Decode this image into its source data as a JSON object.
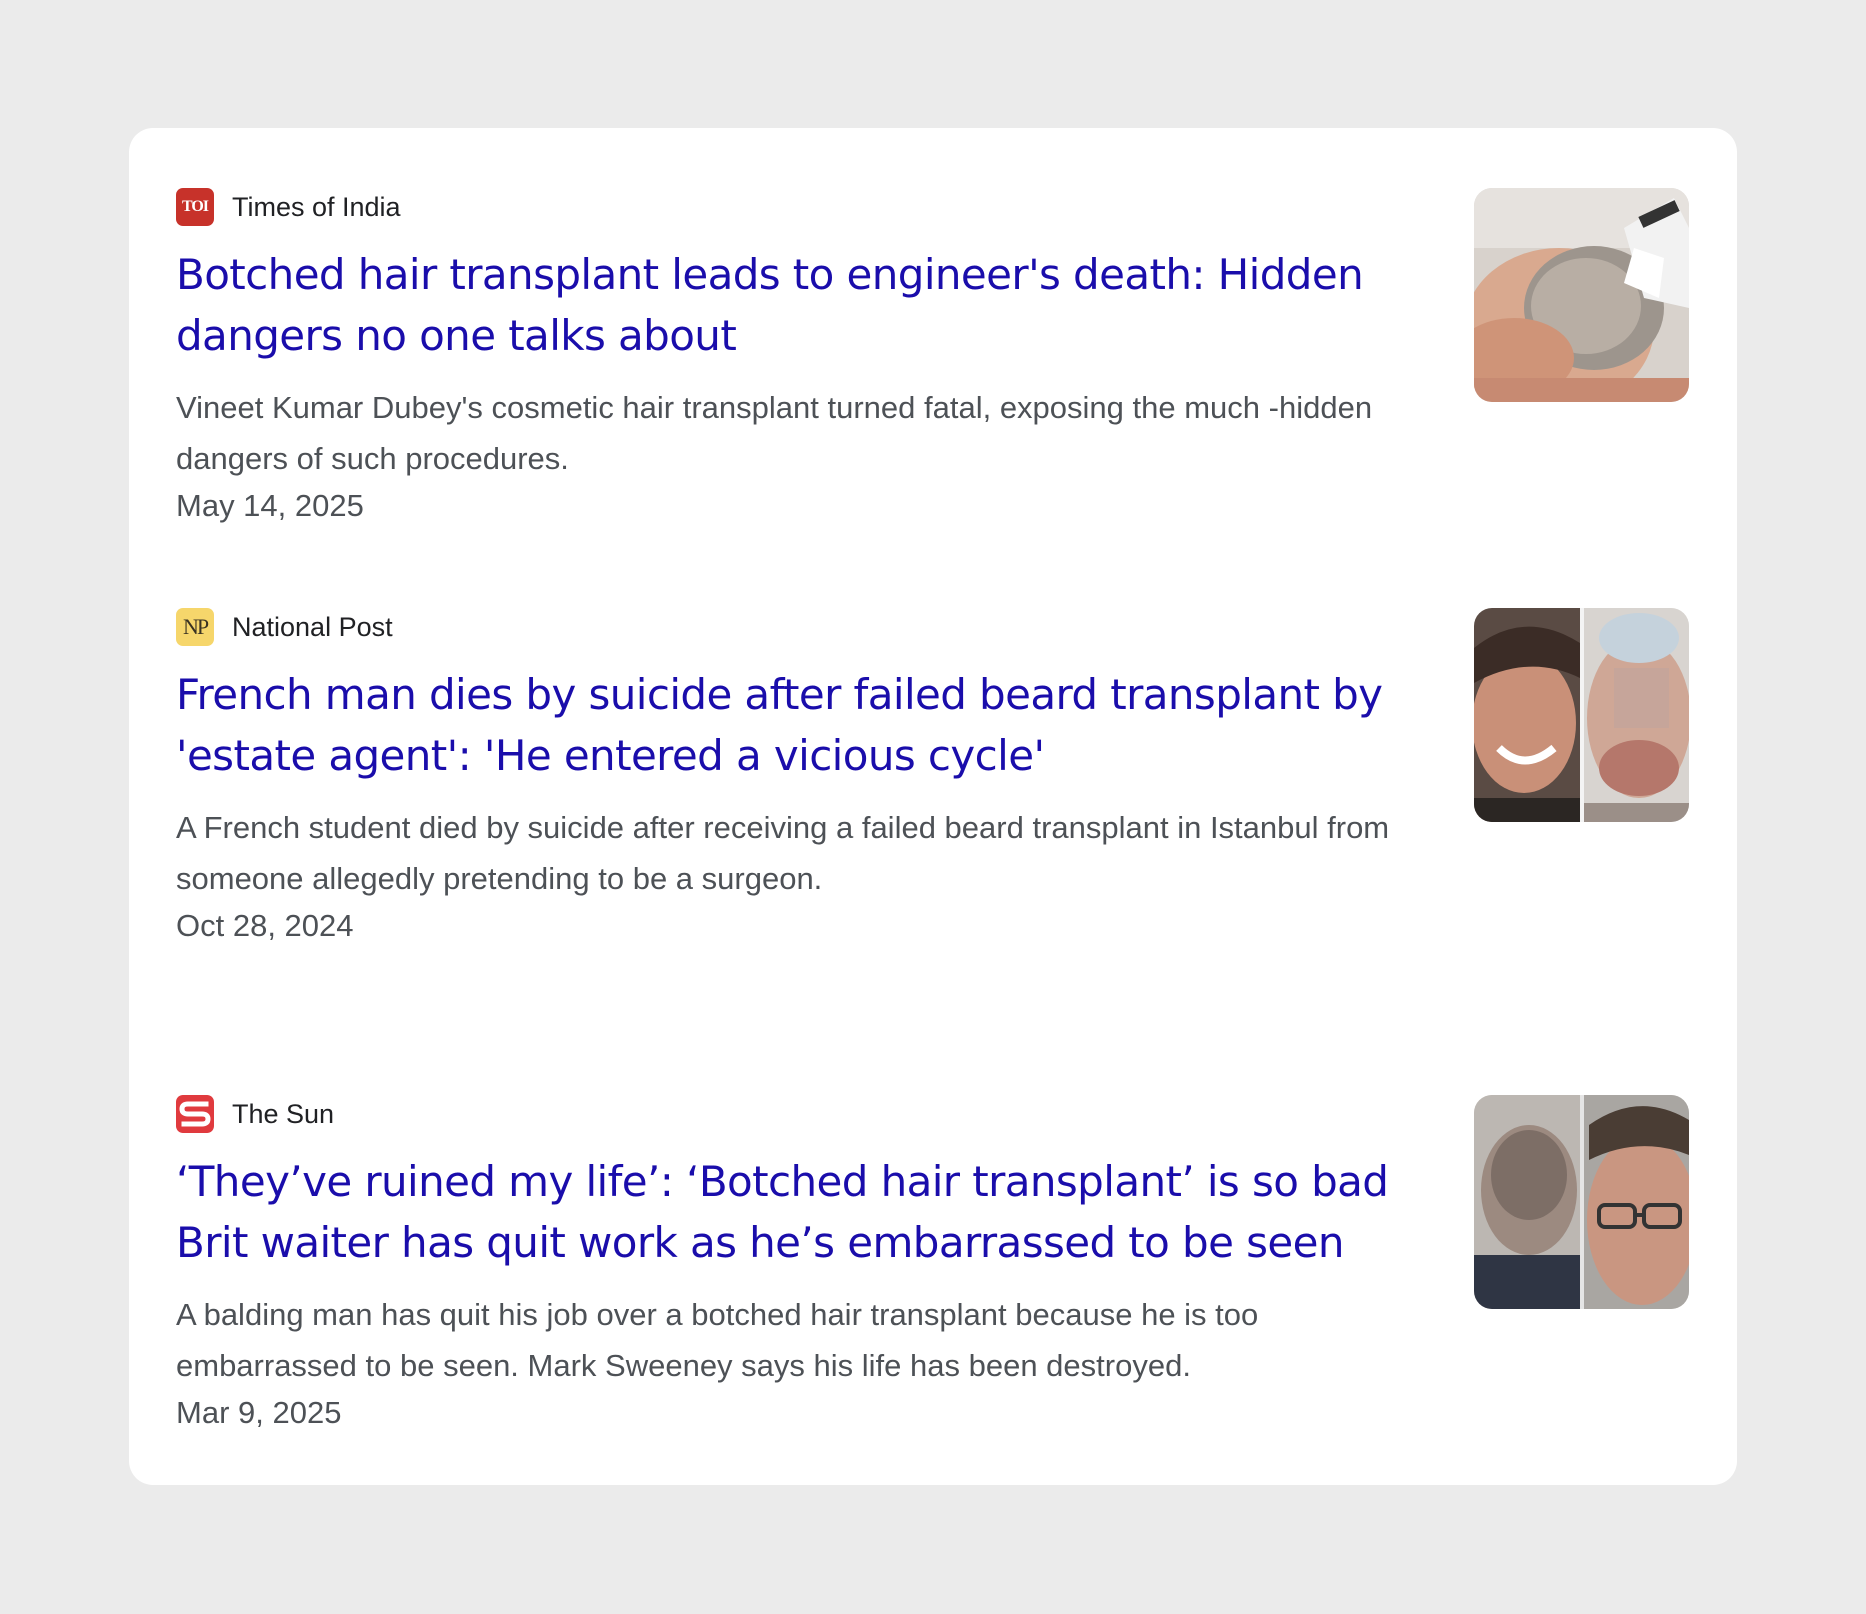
{
  "articles": [
    {
      "source": "Times of India",
      "favicon_text": "TOI",
      "favicon_icon": "times-of-india-logo-icon",
      "headline": "Botched hair transplant leads to engineer's death: Hidden dangers no one talks about",
      "snippet": "Vineet Kumar Dubey's cosmetic hair transplant turned fatal, exposing the much -hidden dangers of such procedures.",
      "date": "May 14, 2025"
    },
    {
      "source": "National Post",
      "favicon_text": "NP",
      "favicon_icon": "national-post-logo-icon",
      "headline": "French man dies by suicide after failed beard transplant by 'estate agent': 'He entered a vicious cycle'",
      "snippet": "A French student died by suicide after receiving a failed beard transplant in Istanbul from someone allegedly pretending to be a surgeon.",
      "date": "Oct 28, 2024"
    },
    {
      "source": "The Sun",
      "favicon_text": "S",
      "favicon_icon": "the-sun-logo-icon",
      "headline": "‘They’ve ruined my life’: ‘Botched hair transplant’ is so bad Brit waiter has quit work as he’s embarrassed to be seen",
      "snippet": "A balding man has quit his job over a botched hair transplant because he is too embarrassed to be seen. Mark Sweeney says his life has been destroyed.",
      "date": "Mar 9, 2025"
    }
  ],
  "colors": {
    "page_background": "#ebebeb",
    "card_background": "#ffffff",
    "headline_link": "#1a0dab",
    "snippet_text": "#4d5156",
    "source_text": "#202124",
    "toi_red": "#c7322a",
    "np_yellow": "#f6d66b",
    "sun_red": "#e03a3e"
  }
}
